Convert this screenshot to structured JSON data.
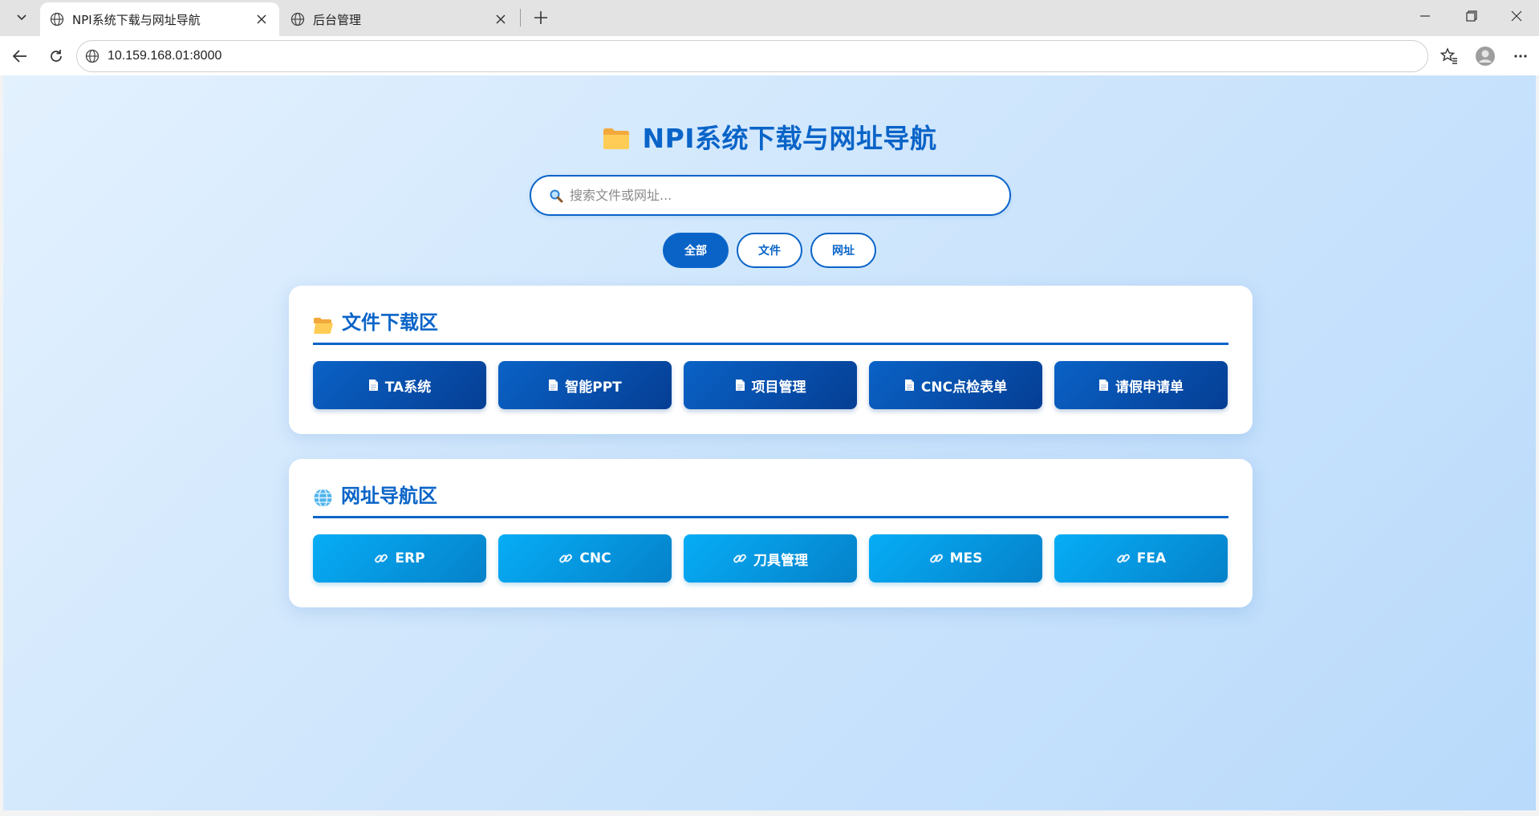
{
  "browser": {
    "tabs": [
      {
        "title": "NPI系统下载与网址导航",
        "active": true
      },
      {
        "title": "后台管理",
        "active": false
      }
    ],
    "url": "10.159.168.01:8000"
  },
  "page": {
    "title": "NPI系统下载与网址导航",
    "search": {
      "placeholder": "搜索文件或网址..."
    },
    "filters": [
      {
        "label": "全部",
        "active": true
      },
      {
        "label": "文件",
        "active": false
      },
      {
        "label": "网址",
        "active": false
      }
    ],
    "files_section": {
      "title": "文件下载区",
      "items": [
        "TA系统",
        "智能PPT",
        "项目管理",
        "CNC点检表单",
        "请假申请单"
      ]
    },
    "links_section": {
      "title": "网址导航区",
      "items": [
        "ERP",
        "CNC",
        "刀具管理",
        "MES",
        "FEA"
      ]
    }
  },
  "colors": {
    "accent": "#0a64c8",
    "file_card": "#0a62c6",
    "link_card": "#06adf6",
    "background": "#cfe6fc"
  },
  "icons": {
    "title": "folder-icon",
    "search": "magnifier-icon",
    "file_section": "open-folder-icon",
    "link_section": "globe-icon",
    "file_card": "document-icon",
    "link_card": "chain-link-icon"
  }
}
